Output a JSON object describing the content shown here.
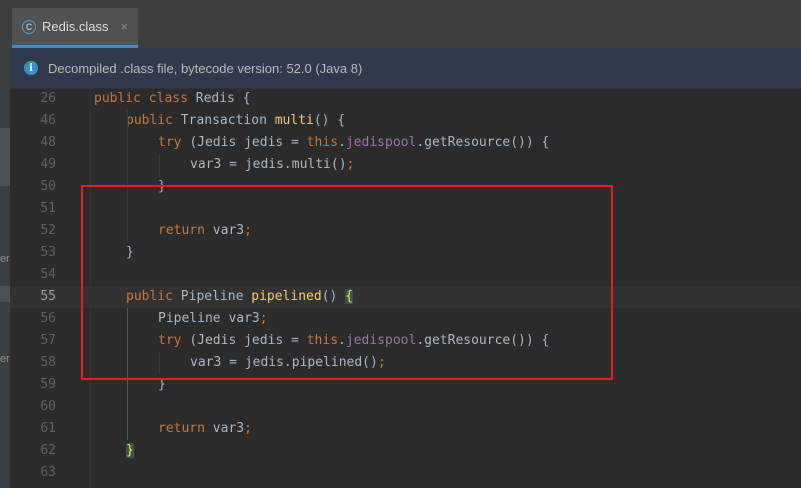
{
  "window": {
    "side_strip_letters": [
      "er",
      "er"
    ]
  },
  "tab": {
    "icon_letter": "C",
    "title": "Redis.class",
    "close_glyph": "×"
  },
  "banner": {
    "icon": "i",
    "text": "Decompiled .class file, bytecode version: 52.0 (Java 8)"
  },
  "editor": {
    "current_line": "55",
    "lines": [
      {
        "num": "26",
        "indent": 0,
        "tokens": [
          {
            "t": "public class ",
            "c": "kw"
          },
          {
            "t": "Redis {",
            "c": ""
          }
        ]
      },
      {
        "num": "46",
        "indent": 1,
        "tokens": [
          {
            "t": "public ",
            "c": "kw"
          },
          {
            "t": "Transaction ",
            "c": ""
          },
          {
            "t": "multi",
            "c": "fn"
          },
          {
            "t": "() {",
            "c": ""
          }
        ]
      },
      {
        "num": "48",
        "indent": 2,
        "tokens": [
          {
            "t": "try ",
            "c": "kw"
          },
          {
            "t": "(Jedis jedis = ",
            "c": ""
          },
          {
            "t": "this",
            "c": "kw"
          },
          {
            "t": ".",
            "c": ""
          },
          {
            "t": "jedispool",
            "c": "fld"
          },
          {
            "t": ".getResource()) {",
            "c": ""
          }
        ]
      },
      {
        "num": "49",
        "indent": 3,
        "tokens": [
          {
            "t": "var3 = jedis.multi()",
            "c": ""
          },
          {
            "t": ";",
            "c": "semi"
          }
        ]
      },
      {
        "num": "50",
        "indent": 2,
        "tokens": [
          {
            "t": "}",
            "c": ""
          }
        ]
      },
      {
        "num": "51",
        "indent": 0,
        "tokens": []
      },
      {
        "num": "52",
        "indent": 2,
        "tokens": [
          {
            "t": "return ",
            "c": "kw"
          },
          {
            "t": "var3",
            "c": ""
          },
          {
            "t": ";",
            "c": "semi"
          }
        ]
      },
      {
        "num": "53",
        "indent": 1,
        "tokens": [
          {
            "t": "}",
            "c": ""
          }
        ]
      },
      {
        "num": "54",
        "indent": 0,
        "tokens": []
      },
      {
        "num": "55",
        "indent": 1,
        "tokens": [
          {
            "t": "public ",
            "c": "kw"
          },
          {
            "t": "Pipeline ",
            "c": ""
          },
          {
            "t": "pipelined",
            "c": "fn"
          },
          {
            "t": "() ",
            "c": ""
          },
          {
            "t": "{",
            "c": "brace-match"
          }
        ]
      },
      {
        "num": "56",
        "indent": 2,
        "tokens": [
          {
            "t": "Pipeline var3",
            "c": ""
          },
          {
            "t": ";",
            "c": "semi"
          }
        ]
      },
      {
        "num": "57",
        "indent": 2,
        "tokens": [
          {
            "t": "try ",
            "c": "kw"
          },
          {
            "t": "(Jedis jedis = ",
            "c": ""
          },
          {
            "t": "this",
            "c": "kw"
          },
          {
            "t": ".",
            "c": ""
          },
          {
            "t": "jedispool",
            "c": "fld"
          },
          {
            "t": ".getResource()) {",
            "c": ""
          }
        ]
      },
      {
        "num": "58",
        "indent": 3,
        "tokens": [
          {
            "t": "var3 = jedis.pipelined()",
            "c": ""
          },
          {
            "t": ";",
            "c": "semi"
          }
        ]
      },
      {
        "num": "59",
        "indent": 2,
        "tokens": [
          {
            "t": "}",
            "c": ""
          }
        ]
      },
      {
        "num": "60",
        "indent": 0,
        "tokens": []
      },
      {
        "num": "61",
        "indent": 2,
        "tokens": [
          {
            "t": "return ",
            "c": "kw"
          },
          {
            "t": "var3",
            "c": ""
          },
          {
            "t": ";",
            "c": "semi"
          }
        ]
      },
      {
        "num": "62",
        "indent": 1,
        "tokens": [
          {
            "t": "}",
            "c": "brace-match"
          }
        ]
      },
      {
        "num": "63",
        "indent": 0,
        "tokens": []
      }
    ]
  },
  "colors": {
    "keyword": "#cc7832",
    "method": "#ffc66d",
    "field": "#9876aa",
    "default": "#a9b7c6",
    "annotation_box": "#e02020"
  }
}
